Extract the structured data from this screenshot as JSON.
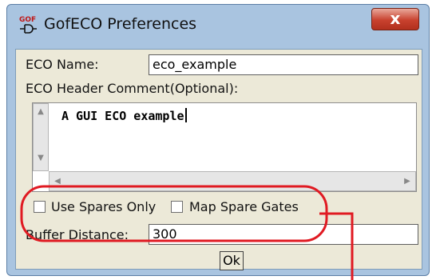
{
  "window": {
    "title": "GofECO Preferences",
    "icon": "gof-app-icon",
    "icon_text": "GOF",
    "close_label": "x"
  },
  "form": {
    "eco_name_label": "ECO Name:",
    "eco_name_value": "eco_example",
    "header_comment_label": "ECO Header Comment(Optional):",
    "header_comment_value": "A GUI ECO example",
    "use_spares_label": "Use Spares Only",
    "use_spares_checked": false,
    "map_spare_label": "Map Spare Gates",
    "map_spare_checked": false,
    "buffer_label": "Buffer Distance:",
    "buffer_value": "300",
    "ok_label": "Ok"
  },
  "annotation": {
    "color": "#e01a22"
  }
}
